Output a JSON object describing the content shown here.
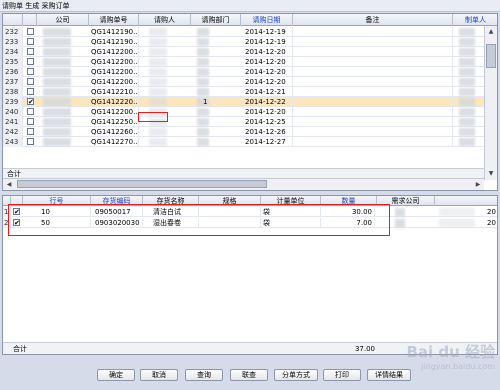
{
  "window": {
    "title": "请购单 生成 采购订单"
  },
  "top_grid": {
    "columns": [
      "公司",
      "请购单号",
      "请购人",
      "请购部门",
      "请购日期",
      "备注",
      "制单人"
    ],
    "rows": [
      {
        "num": "232",
        "order_no": "QG1412190...",
        "date": "2014-12-19",
        "selected": false,
        "checked": false
      },
      {
        "num": "233",
        "order_no": "QG1412190...",
        "date": "2014-12-19",
        "selected": false,
        "checked": false
      },
      {
        "num": "234",
        "order_no": "QG1412200...",
        "date": "2014-12-20",
        "selected": false,
        "checked": false
      },
      {
        "num": "235",
        "order_no": "QG1412200...",
        "date": "2014-12-20",
        "selected": false,
        "checked": false
      },
      {
        "num": "236",
        "order_no": "QG1412200...",
        "date": "2014-12-20",
        "selected": false,
        "checked": false
      },
      {
        "num": "237",
        "order_no": "QG1412200...",
        "date": "2014-12-20",
        "selected": false,
        "checked": false
      },
      {
        "num": "238",
        "order_no": "QG1412210...",
        "date": "2014-12-21",
        "selected": false,
        "checked": false
      },
      {
        "num": "239",
        "order_no": "QG1412220...",
        "date": "2014-12-22",
        "selected": true,
        "checked": true,
        "dept_note": "1"
      },
      {
        "num": "240",
        "order_no": "QG1412200...",
        "date": "2014-12-20",
        "selected": false,
        "checked": false
      },
      {
        "num": "241",
        "order_no": "QG1412250...",
        "date": "2014-12-25",
        "selected": false,
        "checked": false
      },
      {
        "num": "242",
        "order_no": "QG1412260...",
        "date": "2014-12-26",
        "selected": false,
        "checked": false
      },
      {
        "num": "243",
        "order_no": "QG1412270...",
        "date": "2014-12-27",
        "selected": false,
        "checked": false
      }
    ],
    "total_label": "合计"
  },
  "bottom_grid": {
    "columns": [
      "行号",
      "存货编码",
      "存货名称",
      "规格",
      "计量单位",
      "数量",
      "需求公司"
    ],
    "rows": [
      {
        "num": "1",
        "line": "10",
        "code": "09050017",
        "name": "清洁白试",
        "unit": "袋",
        "qty": "30.00",
        "extra": "20",
        "checked": true
      },
      {
        "num": "2",
        "line": "50",
        "code": "0903020030",
        "name": "湿出春卷",
        "unit": "袋",
        "qty": "7.00",
        "extra": "20",
        "checked": true
      }
    ],
    "total_label": "合计",
    "total_qty": "37.00"
  },
  "buttons": [
    "确定",
    "取消",
    "查询",
    "联查",
    "分单方式",
    "打印",
    "详情结果"
  ],
  "watermark": {
    "main": "Bai du 经验",
    "sub": "jingyan.baidu.com"
  }
}
